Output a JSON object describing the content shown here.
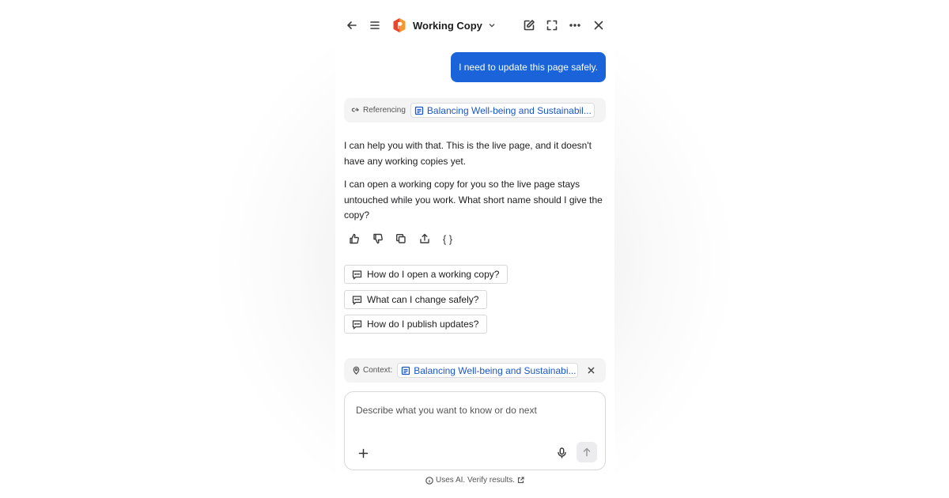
{
  "header": {
    "title": "Working Copy",
    "back_icon": "arrow-left-icon",
    "menu_icon": "hamburger-menu-icon",
    "logo_icon": "hexagon-logo-icon",
    "actions": [
      "new-chat-icon",
      "expand-icon",
      "more-icon",
      "close-icon"
    ]
  },
  "conversation": {
    "user_message": "I need to update this page safely.",
    "referencing_label": "Referencing",
    "referenced_doc": "Balancing Well-being and Sustainabil...",
    "reply_paragraphs": [
      "I can help you with that. This is the live page, and it doesn't have any working copies yet.",
      "I can open a working copy for you so the live page stays untouched while you work. What short name should I give the copy?"
    ],
    "feedback_actions": [
      "thumbs-up-icon",
      "thumbs-down-icon",
      "copy-icon",
      "share-icon",
      "json-braces-icon"
    ],
    "braces_glyph": "{ }"
  },
  "suggestions": [
    "How do I open a working copy?",
    "What can I change safely?",
    "How do I publish updates?"
  ],
  "context": {
    "label": "Context:",
    "doc": "Balancing Well-being and Sustainabi..."
  },
  "composer": {
    "placeholder": "Describe what you want to know or do next",
    "value": ""
  },
  "footer": {
    "disclaimer": "Uses AI. Verify results."
  },
  "colors": {
    "accent": "#1a63d9",
    "link": "#1a56c9",
    "logo": "#e8452c"
  }
}
